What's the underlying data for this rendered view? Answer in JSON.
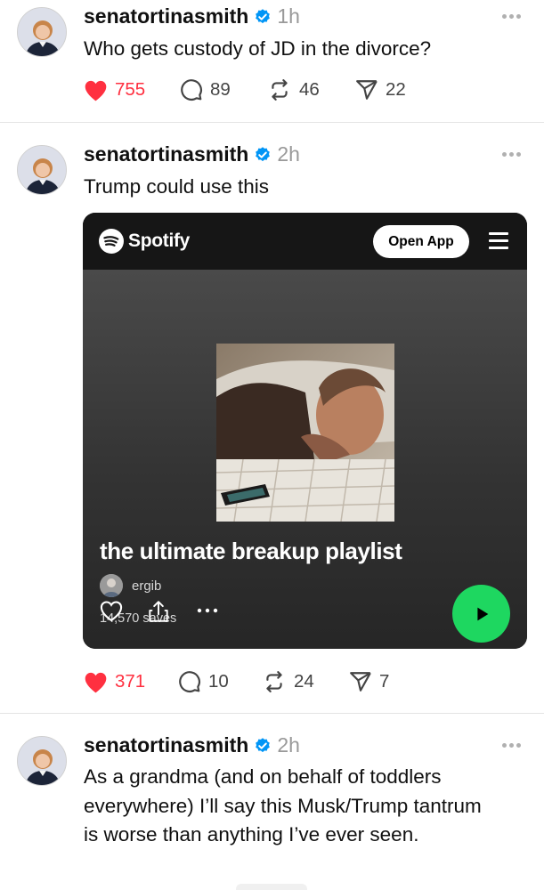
{
  "posts": [
    {
      "username": "senatortinasmith",
      "time": "1h",
      "text": "Who gets custody of JD in the divorce?",
      "likes": "755",
      "comments": "89",
      "reposts": "46",
      "shares": "22"
    },
    {
      "username": "senatortinasmith",
      "time": "2h",
      "text": "Trump could use this",
      "likes": "371",
      "comments": "10",
      "reposts": "24",
      "shares": "7",
      "embed": {
        "brand": "Spotify",
        "open_app_label": "Open App",
        "playlist_title": "the ultimate breakup playlist",
        "owner": "ergib",
        "saves": "14,570 saves"
      }
    },
    {
      "username": "senatortinasmith",
      "time": "2h",
      "text": "As a grandma (and on behalf of toddlers everywhere) I’ll say this Musk/Trump tantrum is worse than anything I’ve ever seen."
    }
  ],
  "icons": {
    "verified": "verified-badge-icon",
    "more": "more-dots-icon",
    "like": "heart-icon",
    "comment": "comment-bubble-icon",
    "repost": "repost-icon",
    "share": "send-icon"
  },
  "colors": {
    "like": "#ff3040",
    "verified": "#0095f6",
    "spotify_green": "#1ed760",
    "card_bg": "#262626"
  }
}
